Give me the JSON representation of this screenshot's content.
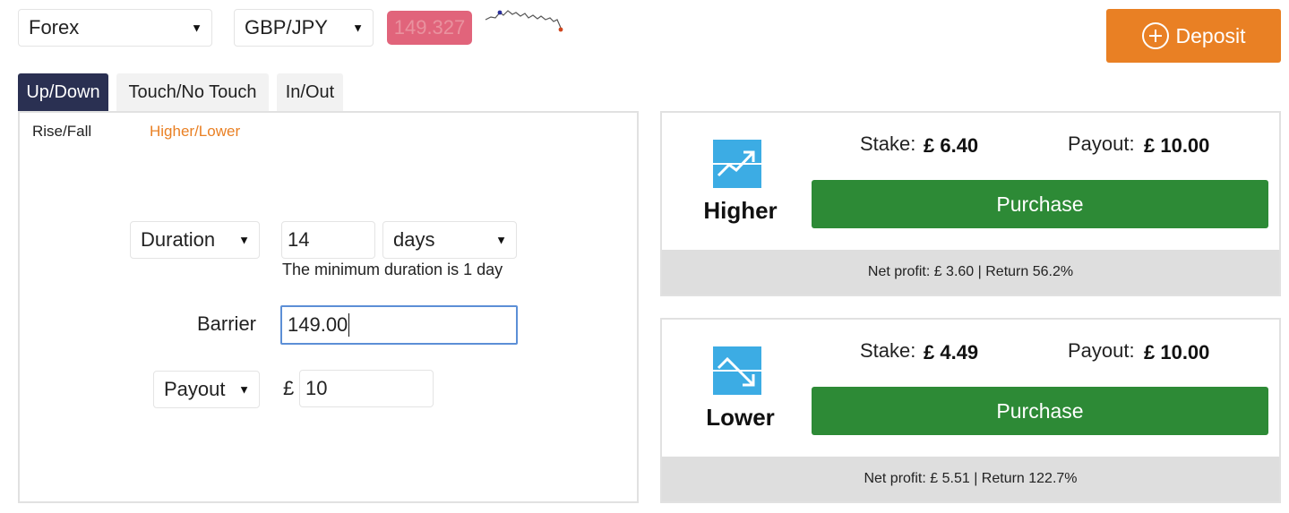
{
  "market_select": {
    "value": "Forex"
  },
  "symbol_select": {
    "value": "GBP/JPY"
  },
  "spot_price": "149.327",
  "colors": {
    "spot_price_bg": "#e1647b",
    "deposit_bg": "#e98024",
    "active_tab_bg": "#2a3052",
    "purchase_bg": "#2d8a36",
    "subtab_active": "#e98024",
    "contract_icon_bg": "#3cace4"
  },
  "deposit_button": {
    "label": "Deposit",
    "icon": "plus-circle-icon"
  },
  "tabs": [
    {
      "label": "Up/Down",
      "active": true
    },
    {
      "label": "Touch/No Touch",
      "active": false
    },
    {
      "label": "In/Out",
      "active": false
    }
  ],
  "subtabs": [
    {
      "label": "Rise/Fall",
      "active": false
    },
    {
      "label": "Higher/Lower",
      "active": true
    }
  ],
  "form": {
    "duration_select": "Duration",
    "duration_value": "14",
    "duration_unit": "days",
    "duration_hint": "The minimum duration is 1 day",
    "barrier_label": "Barrier",
    "barrier_value": "149.00",
    "amount_type_select": "Payout",
    "currency_symbol": "£",
    "amount_value": "10"
  },
  "contracts": [
    {
      "name": "Higher",
      "icon": "trend-up-icon",
      "stake_label": "Stake:",
      "stake_value": "£ 6.40",
      "payout_label": "Payout:",
      "payout_value": "£ 10.00",
      "purchase_label": "Purchase",
      "footer": "Net profit: £ 3.60 | Return 56.2%"
    },
    {
      "name": "Lower",
      "icon": "trend-down-icon",
      "stake_label": "Stake:",
      "stake_value": "£ 4.49",
      "payout_label": "Payout:",
      "payout_value": "£ 10.00",
      "purchase_label": "Purchase",
      "footer": "Net profit: £ 5.51 | Return 122.7%"
    }
  ]
}
